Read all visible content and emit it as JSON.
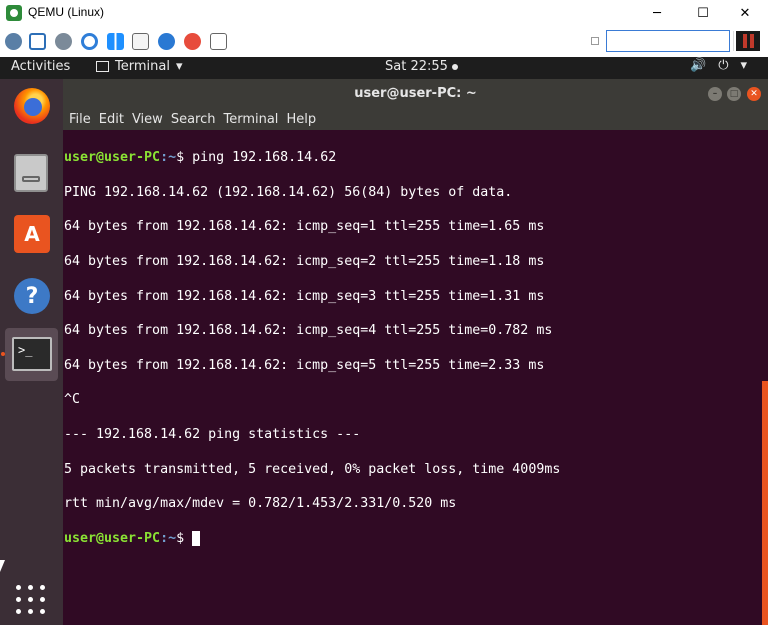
{
  "qemu": {
    "title": "QEMU (Linux)",
    "controls": {
      "minimize": "─",
      "maximize": "☐",
      "close": "✕"
    },
    "toolbar_icons": [
      "settings-icon",
      "fullscreen-icon",
      "gear-icon",
      "refresh-icon",
      "windows-icon",
      "terminal-box-icon",
      "info-icon",
      "stop-icon",
      "clipboard-icon"
    ],
    "search_placeholder": ""
  },
  "ubuntu_topbar": {
    "activities": "Activities",
    "app_menu": "Terminal",
    "clock": "Sat 22:55"
  },
  "dock": {
    "items": [
      "firefox-icon",
      "files-icon",
      "software-icon",
      "help-icon",
      "terminal-icon"
    ],
    "software_glyph": "A",
    "help_glyph": "?",
    "terminal_glyph": ">_"
  },
  "terminal": {
    "title": "user@user-PC: ~",
    "menu": [
      "File",
      "Edit",
      "View",
      "Search",
      "Terminal",
      "Help"
    ],
    "prompt_user": "user@user-PC",
    "prompt_path": ":~",
    "prompt_symbol": "$ ",
    "command": "ping 192.168.14.62",
    "output": [
      "PING 192.168.14.62 (192.168.14.62) 56(84) bytes of data.",
      "64 bytes from 192.168.14.62: icmp_seq=1 ttl=255 time=1.65 ms",
      "64 bytes from 192.168.14.62: icmp_seq=2 ttl=255 time=1.18 ms",
      "64 bytes from 192.168.14.62: icmp_seq=3 ttl=255 time=1.31 ms",
      "64 bytes from 192.168.14.62: icmp_seq=4 ttl=255 time=0.782 ms",
      "64 bytes from 192.168.14.62: icmp_seq=5 ttl=255 time=2.33 ms",
      "^C",
      "--- 192.168.14.62 ping statistics ---",
      "5 packets transmitted, 5 received, 0% packet loss, time 4009ms",
      "rtt min/avg/max/mdev = 0.782/1.453/2.331/0.520 ms"
    ]
  },
  "colors": {
    "terminal_bg": "#300a24",
    "prompt_user": "#8ae234",
    "prompt_path": "#729fcf",
    "accent": "#e95420"
  }
}
